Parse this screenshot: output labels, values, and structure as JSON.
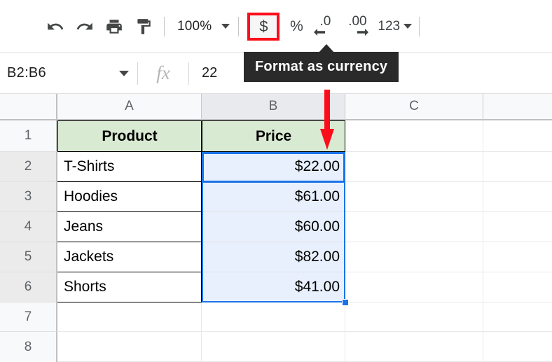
{
  "toolbar": {
    "undo_title": "Undo",
    "redo_title": "Redo",
    "print_title": "Print",
    "paint_title": "Paint format",
    "zoom_value": "100%",
    "currency_label": "$",
    "percent_label": "%",
    "decrease_decimal_label": ".0",
    "increase_decimal_label": ".00",
    "number_format_label": "123",
    "icons": {
      "undo": "undo-icon",
      "redo": "redo-icon",
      "print": "print-icon",
      "paint": "paint-format-icon",
      "zoom_caret": "chevron-down-icon",
      "format_caret": "chevron-down-icon"
    },
    "accent_highlight_color": "#fc0d1b",
    "highlighted_button": "currency"
  },
  "tooltip": {
    "text": "Format as currency",
    "background": "#2a2a2a",
    "text_color": "#ffffff"
  },
  "formula_bar": {
    "name_box_value": "B2:B6",
    "name_box_caret": "chevron-down-icon",
    "fx_label": "fx",
    "formula_value": "22",
    "formula_placeholder": ""
  },
  "grid": {
    "columns": [
      "A",
      "B",
      "C"
    ],
    "selected_column": "B",
    "rows": [
      "1",
      "2",
      "3",
      "4",
      "5",
      "6",
      "7",
      "8"
    ],
    "selected_rows": [
      "2",
      "3",
      "4",
      "5",
      "6"
    ],
    "header_row": {
      "a": "Product",
      "b": "Price"
    },
    "data": [
      {
        "row": "2",
        "product": "T-Shirts",
        "price": "$22.00"
      },
      {
        "row": "3",
        "product": "Hoodies",
        "price": "$61.00"
      },
      {
        "row": "4",
        "product": "Jeans",
        "price": "$60.00"
      },
      {
        "row": "5",
        "product": "Jackets",
        "price": "$82.00"
      },
      {
        "row": "6",
        "product": "Shorts",
        "price": "$41.00"
      }
    ],
    "empty_rows": [
      "7",
      "8"
    ],
    "selection_range": "B2:B6",
    "active_cell": "B2",
    "selection_border_color": "#1a73e8",
    "selection_fill_color": "#e8f0fe",
    "header_fill_color": "#d9ead3"
  },
  "annotation": {
    "arrow_color": "#fc0d1b",
    "arrow_name": "red-down-arrow"
  }
}
